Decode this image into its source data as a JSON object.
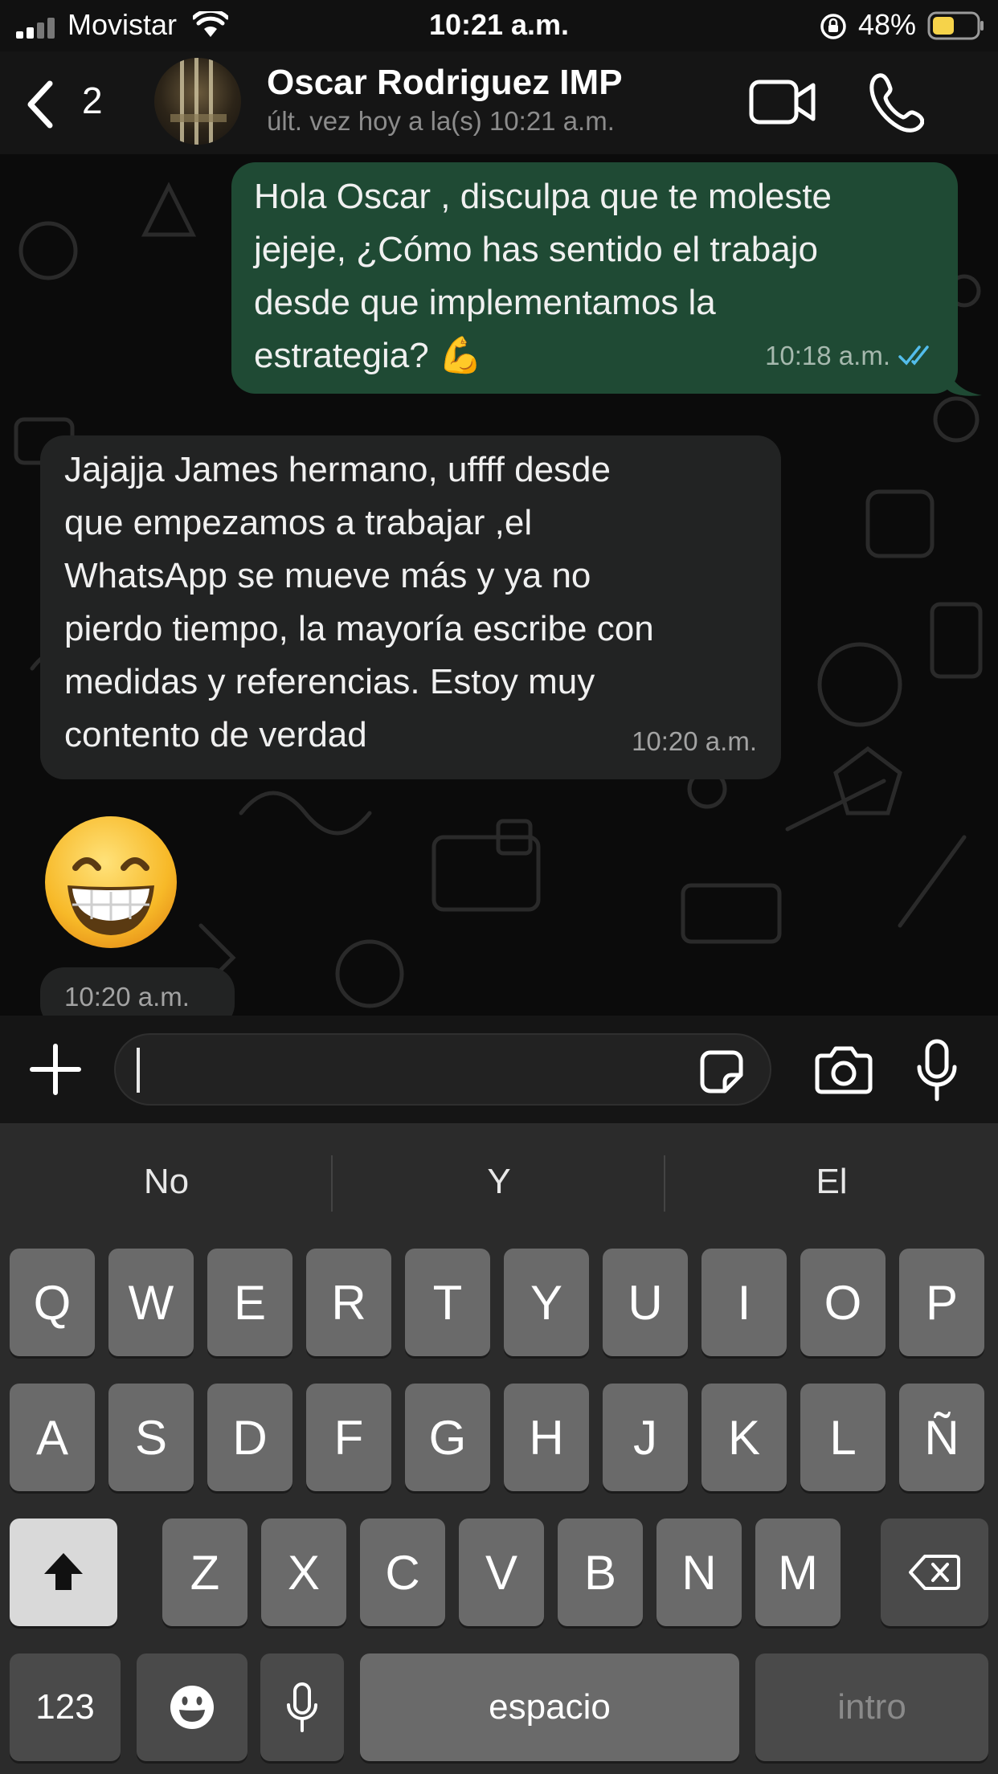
{
  "status_bar": {
    "carrier": "Movistar",
    "time": "10:21 a.m.",
    "battery_percent": "48%",
    "battery_level": 0.48,
    "battery_color": "#f6d34a",
    "icons": [
      "signal-icon",
      "wifi-icon",
      "orientation-lock-icon",
      "battery-icon"
    ]
  },
  "header": {
    "back_count": "2",
    "contact_name": "Oscar Rodriguez IMP",
    "contact_status": "últ. vez hoy a la(s) 10:21 a.m.",
    "icons": [
      "back-chevron-icon",
      "avatar",
      "video-camera-icon",
      "phone-icon"
    ]
  },
  "messages": [
    {
      "direction": "outgoing",
      "text": "Hola Oscar , disculpa que te moleste\njejeje, ¿Cómo has sentido el trabajo\ndesde que implementamos la\nestrategia? 💪",
      "time": "10:18 a.m.",
      "status": "read",
      "status_icon": "double-check-icon",
      "status_color": "#53bdeb"
    },
    {
      "direction": "incoming",
      "text": "Jajajja James hermano, uffff desde\nque empezamos a trabajar ,el\nWhatsApp se mueve más y ya no\npierdo tiempo, la mayoría escribe con\nmedidas y referencias. Estoy muy\ncontento de verdad",
      "time": "10:20 a.m."
    },
    {
      "direction": "incoming",
      "type": "emoji",
      "emoji": "grinning-face-with-smiling-eyes",
      "time": "10:20 a.m."
    }
  ],
  "composer": {
    "input_value": "",
    "icons": [
      "plus-icon",
      "sticker-icon",
      "camera-icon",
      "microphone-icon"
    ]
  },
  "keyboard": {
    "suggestions": [
      "No",
      "Y",
      "El"
    ],
    "row1": [
      "Q",
      "W",
      "E",
      "R",
      "T",
      "Y",
      "U",
      "I",
      "O",
      "P"
    ],
    "row2": [
      "A",
      "S",
      "D",
      "F",
      "G",
      "H",
      "J",
      "K",
      "L",
      "Ñ"
    ],
    "row3": [
      "Z",
      "X",
      "C",
      "V",
      "B",
      "N",
      "M"
    ],
    "numbers_label": "123",
    "space_label": "espacio",
    "return_label": "intro",
    "icons": [
      "shift-icon",
      "backspace-icon",
      "emoji-icon",
      "dictation-mic-icon"
    ]
  },
  "colors": {
    "outgoing_bubble": "#1f4a34",
    "incoming_bubble": "#222323",
    "chat_background": "#0b0b0b",
    "keyboard_background": "#2b2b2b"
  }
}
